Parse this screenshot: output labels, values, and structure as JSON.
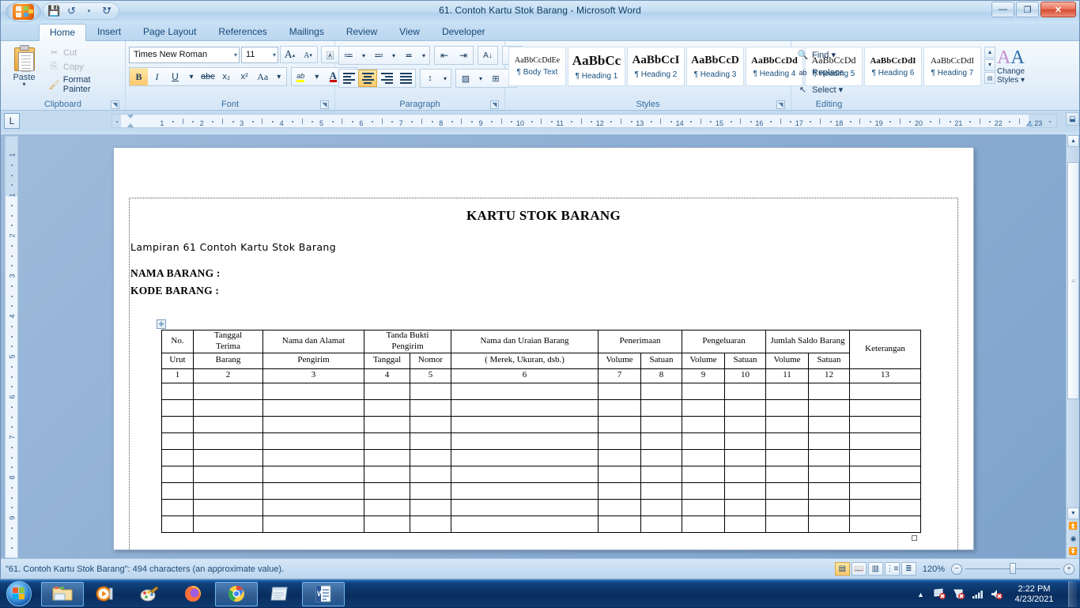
{
  "window": {
    "title": "61. Contoh Kartu Stok Barang - Microsoft Word",
    "minimize_label": "—",
    "maximize_label": "❐",
    "close_label": "✕"
  },
  "quick_access": {
    "save_label": "💾",
    "undo_label": "↺",
    "redo_label": "↻",
    "customize_label": "▾"
  },
  "tabs": [
    {
      "label": "Home",
      "active": true
    },
    {
      "label": "Insert",
      "active": false
    },
    {
      "label": "Page Layout",
      "active": false
    },
    {
      "label": "References",
      "active": false
    },
    {
      "label": "Mailings",
      "active": false
    },
    {
      "label": "Review",
      "active": false
    },
    {
      "label": "View",
      "active": false
    },
    {
      "label": "Developer",
      "active": false
    }
  ],
  "ribbon": {
    "clipboard": {
      "group_label": "Clipboard",
      "paste_label": "Paste",
      "paste_arrow": "▾",
      "cut_label": "Cut",
      "copy_label": "Copy",
      "format_painter_label": "Format Painter"
    },
    "font": {
      "group_label": "Font",
      "font_name": "Times New Roman",
      "font_size": "11",
      "grow_font_label": "A",
      "shrink_font_label": "A",
      "clear_formatting_label": "Aa",
      "bold_label": "B",
      "italic_label": "I",
      "underline_label": "U",
      "strikethrough_label": "abc",
      "subscript_label": "x₂",
      "superscript_label": "x²",
      "change_case_label": "Aa",
      "highlight_label": "ab",
      "font_color_label": "A"
    },
    "paragraph": {
      "group_label": "Paragraph",
      "bullets_label": "≔",
      "numbering_label": "≕",
      "multilevel_label": "≖",
      "decrease_indent_label": "⇤",
      "increase_indent_label": "⇥",
      "sort_label": "A↓",
      "show_marks_label": "¶",
      "align_left_label": "≡",
      "align_center_label": "≡",
      "align_right_label": "≡",
      "justify_label": "≡",
      "line_spacing_label": "↕",
      "shading_label": "▨",
      "borders_label": "⊞"
    },
    "styles": {
      "group_label": "Styles",
      "items": [
        {
          "sample": "AaBbCcDdEe",
          "name": "¶ Body Text",
          "sample_size": "10px",
          "sample_weight": "normal"
        },
        {
          "sample": "AaBbCc",
          "name": "¶ Heading 1",
          "sample_size": "17px",
          "sample_weight": "bold"
        },
        {
          "sample": "AaBbCcI",
          "name": "¶ Heading 2",
          "sample_size": "15px",
          "sample_weight": "bold"
        },
        {
          "sample": "AaBbCcD",
          "name": "¶ Heading 3",
          "sample_size": "14px",
          "sample_weight": "bold"
        },
        {
          "sample": "AaBbCcDd",
          "name": "¶ Heading 4",
          "sample_size": "12px",
          "sample_weight": "bold"
        },
        {
          "sample": "AaBbCcDd",
          "name": "¶ Heading 5",
          "sample_size": "12px",
          "sample_weight": "normal"
        },
        {
          "sample": "AaBbCcDdI",
          "name": "¶ Heading 6",
          "sample_size": "11px",
          "sample_weight": "bold"
        },
        {
          "sample": "AaBbCcDdI",
          "name": "¶ Heading 7",
          "sample_size": "11px",
          "sample_weight": "normal"
        }
      ],
      "change_styles_label_1": "Change",
      "change_styles_label_2": "Styles ▾",
      "nav_up": "▲",
      "nav_down": "▼",
      "nav_more": "▤"
    },
    "editing": {
      "group_label": "Editing",
      "find_label": "Find ▾",
      "replace_label": "Replace",
      "select_label": "Select ▾"
    }
  },
  "ruler": {
    "tab_selector_label": "L",
    "h_ticks": [
      "1",
      "2",
      "3",
      "4",
      "5",
      "6",
      "7",
      "8",
      "9",
      "10",
      "11",
      "12",
      "13",
      "14",
      "15",
      "16",
      "17",
      "18",
      "19",
      "20",
      "21",
      "22",
      "23"
    ],
    "v_ticks": [
      "1",
      "1",
      "2",
      "3",
      "4",
      "5",
      "6",
      "7",
      "8",
      "9"
    ]
  },
  "document": {
    "title": "KARTU STOK BARANG",
    "caption": "Lampiran 61 Contoh Kartu Stok Barang",
    "field_nama": "NAMA BARANG :",
    "field_kode": "KODE BARANG :",
    "table": {
      "header_top": [
        {
          "text": "No.",
          "line2": "Urut",
          "rowspan_style": "split"
        },
        {
          "text": "Tanggal",
          "line2": "Terima"
        },
        {
          "text": "Nama dan Alamat"
        },
        {
          "text": "Tanda Bukti",
          "line2": "Pengirim"
        },
        {
          "text": "Nama dan Uraian Barang"
        },
        {
          "text": "Penerimaan"
        },
        {
          "text": "Pengeluaran"
        },
        {
          "text": "Jumlah Saldo Barang"
        },
        {
          "text": "Keterangan"
        }
      ],
      "row1": [
        "No.",
        "Tanggal\nTerima",
        "Nama dan Alamat",
        "Tanda Bukti\nPengirim",
        "Nama dan Uraian Barang",
        "Penerimaan",
        "Pengeluaran",
        "Jumlah Saldo Barang",
        "Keterangan"
      ],
      "row2": [
        "Urut",
        "Barang",
        "Pengirim",
        "Tanggal",
        "Nomor",
        "( Merek, Ukuran, dsb.)",
        "Volume",
        "Satuan",
        "Volume",
        "Satuan",
        "Volume",
        "Satuan"
      ],
      "number_row": [
        "1",
        "2",
        "3",
        "4",
        "5",
        "6",
        "7",
        "8",
        "9",
        "10",
        "11",
        "12",
        "13"
      ],
      "empty_row_count": 9,
      "col_count": 13
    }
  },
  "statusbar": {
    "message": "\"61. Contoh Kartu Stok Barang\": 494 characters (an approximate value).",
    "views": [
      {
        "name": "print-layout",
        "glyph": "▤",
        "active": true
      },
      {
        "name": "full-screen-reading",
        "glyph": "📖",
        "active": false
      },
      {
        "name": "web-layout",
        "glyph": "▥",
        "active": false
      },
      {
        "name": "outline",
        "glyph": "⋮≡",
        "active": false
      },
      {
        "name": "draft",
        "glyph": "≣",
        "active": false
      }
    ],
    "zoom_level": "120%",
    "zoom_out_label": "−",
    "zoom_in_label": "+"
  },
  "scrollbar": {
    "up_label": "▲",
    "down_label": "▼",
    "prev_page_label": "⏫",
    "select_object_label": "◉",
    "next_page_label": "⏬",
    "split_label": "⬓"
  },
  "taskbar": {
    "start_label": "Start",
    "items": [
      {
        "name": "windows-explorer",
        "active": false
      },
      {
        "name": "windows-media-player",
        "active": false
      },
      {
        "name": "paint",
        "active": false
      },
      {
        "name": "firefox",
        "active": false
      },
      {
        "name": "google-chrome",
        "active": true
      },
      {
        "name": "notepad",
        "active": false
      },
      {
        "name": "microsoft-word",
        "active": true
      }
    ],
    "tray": {
      "show_hidden_label": "▲",
      "network_label": "network-error",
      "action_center_label": "action-center-error",
      "signal_label": "signal",
      "volume_label": "volume-muted"
    },
    "clock": {
      "time": "2:22 PM",
      "date": "4/23/2021"
    }
  }
}
